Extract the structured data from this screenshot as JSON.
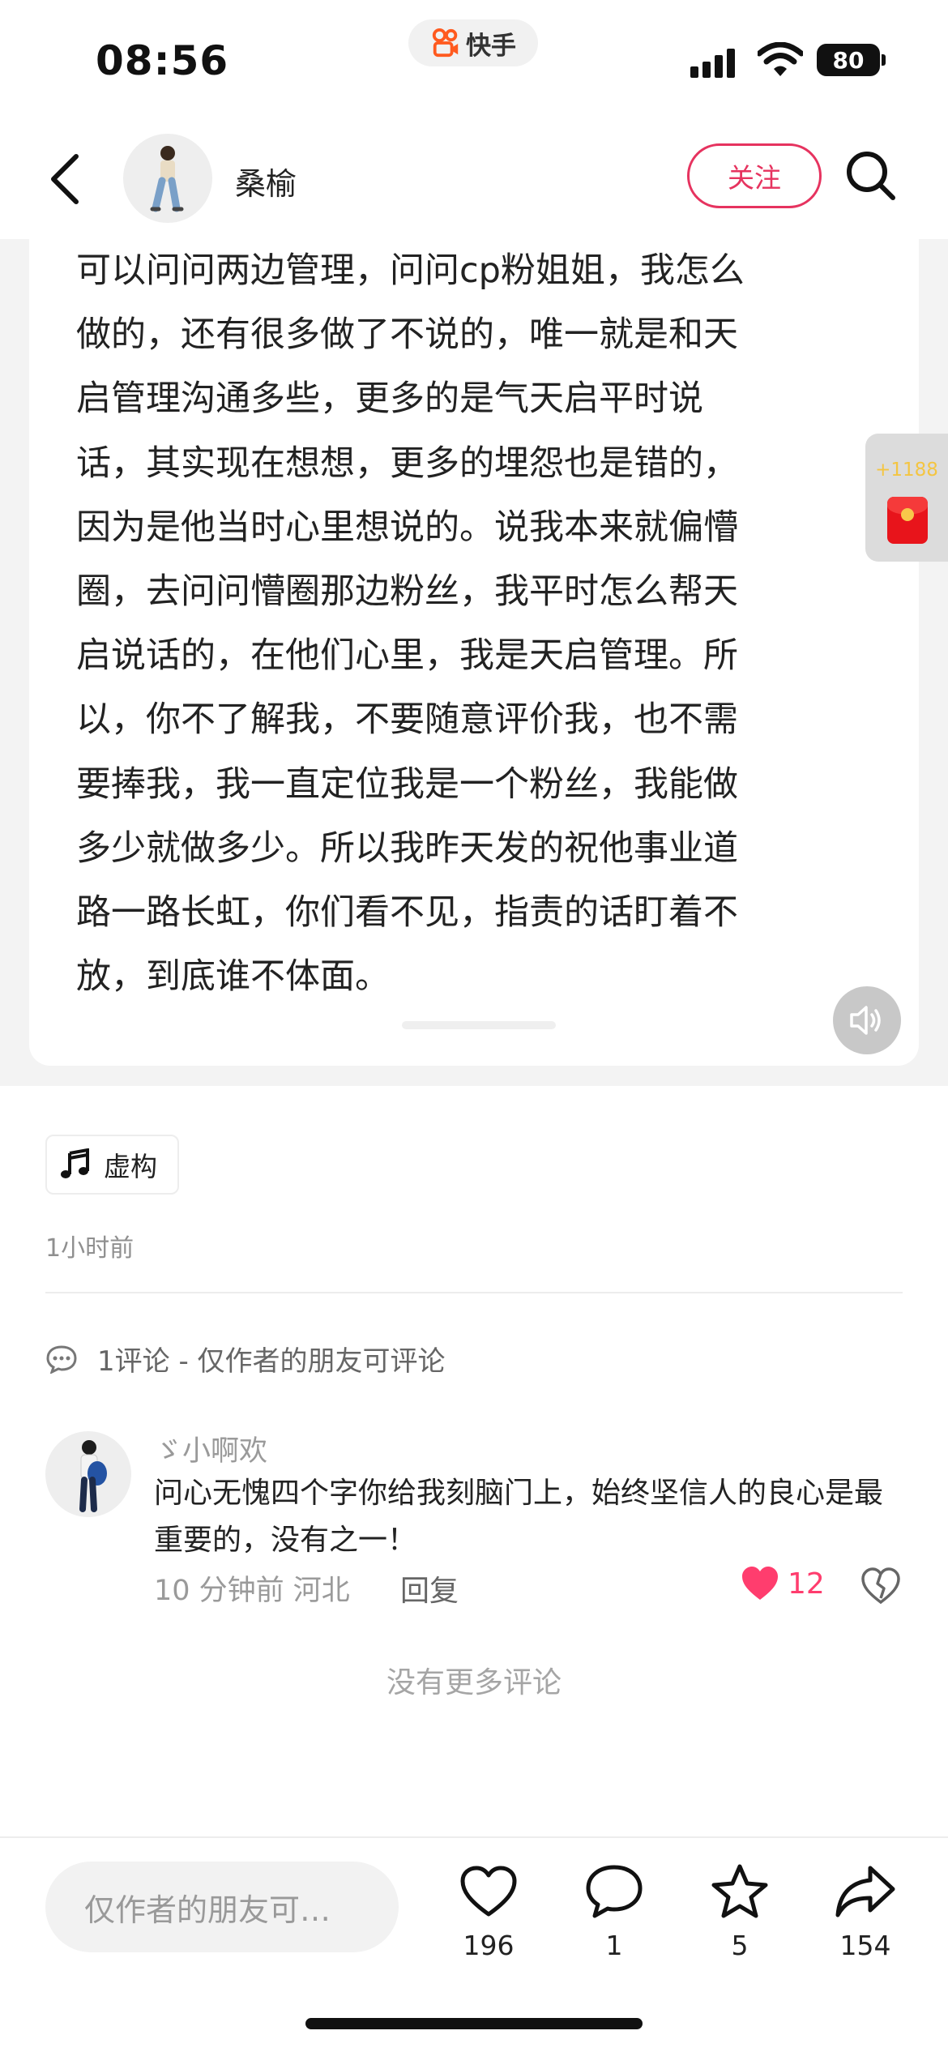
{
  "status_bar": {
    "time": "08:56",
    "app_name": "快手",
    "battery": "80"
  },
  "header": {
    "author_name": "桑榆",
    "follow_label": "关注"
  },
  "post": {
    "lines": [
      "可以问问两边管理，问问cp粉姐姐，我怎么",
      "做的，还有很多做了不说的，唯一就是和天",
      "启管理沟通多些，更多的是气天启平时说",
      "话，其实现在想想，更多的埋怨也是错的，",
      "因为是他当时心里想说的。说我本来就偏懵",
      "圈，去问问懵圈那边粉丝，我平时怎么帮天",
      "启说话的，在他们心里，我是天启管理。所",
      "以，你不了解我，不要随意评价我，也不需",
      "要捧我，我一直定位我是一个粉丝，我能做",
      "多少就做多少。所以我昨天发的祝他事业道",
      "路一路长虹，你们看不见，指责的话盯着不",
      "放，到底谁不体面。"
    ]
  },
  "red_packet": {
    "count": "+1188"
  },
  "music": {
    "label": "虚构"
  },
  "post_time": "1小时前",
  "comments": {
    "title": "1评论 - 仅作者的朋友可评论",
    "items": [
      {
        "user": "ゞ小啊欢",
        "text": "问心无愧四个字你给我刻脑门上，始终坚信人的良心是最重要的，没有之一！",
        "meta": "10 分钟前  河北",
        "reply_label": "回复",
        "likes": "12"
      }
    ],
    "no_more": "没有更多评论"
  },
  "bottom_bar": {
    "input_placeholder": "仅作者的朋友可…",
    "like_count": "196",
    "comment_count": "1",
    "favorite_count": "5",
    "share_count": "154"
  },
  "colors": {
    "accent": "#e6335f",
    "like": "#ff3d6e",
    "red_packet": "#e8141b"
  }
}
